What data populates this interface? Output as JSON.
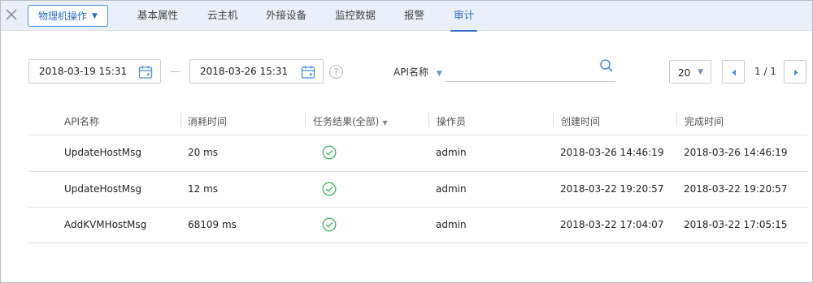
{
  "topbar": {
    "action_label": "物理机操作",
    "tabs": [
      {
        "label": "基本属性",
        "active": false
      },
      {
        "label": "云主机",
        "active": false
      },
      {
        "label": "外接设备",
        "active": false
      },
      {
        "label": "监控数据",
        "active": false
      },
      {
        "label": "报警",
        "active": false
      },
      {
        "label": "审计",
        "active": true
      }
    ]
  },
  "filters": {
    "start_date": "2018-03-19 15:31",
    "end_date": "2018-03-26 15:31",
    "help_glyph": "?",
    "field_label": "API名称",
    "search_value": "",
    "page_size": "20",
    "page_info": "1 / 1"
  },
  "table": {
    "headers": {
      "api": "API名称",
      "duration": "消耗时间",
      "result": "任务结果(全部)",
      "operator": "操作员",
      "created": "创建时间",
      "finished": "完成时间"
    },
    "rows": [
      {
        "api": "UpdateHostMsg",
        "duration": "20 ms",
        "operator": "admin",
        "created": "2018-03-26 14:46:19",
        "finished": "2018-03-26 14:46:19"
      },
      {
        "api": "UpdateHostMsg",
        "duration": "12 ms",
        "operator": "admin",
        "created": "2018-03-22 19:20:57",
        "finished": "2018-03-22 19:20:57"
      },
      {
        "api": "AddKVMHostMsg",
        "duration": "68109 ms",
        "operator": "admin",
        "created": "2018-03-22 17:04:07",
        "finished": "2018-03-22 17:05:15"
      }
    ]
  },
  "colors": {
    "accent": "#2d6fc9",
    "success": "#3cba62",
    "topbar_bg": "#e9f0f9"
  },
  "icons": {
    "close": "close-icon",
    "calendar": "calendar-icon",
    "search": "search-icon",
    "prev": "chevron-left-icon",
    "next": "chevron-right-icon",
    "success": "check-circle-icon"
  }
}
